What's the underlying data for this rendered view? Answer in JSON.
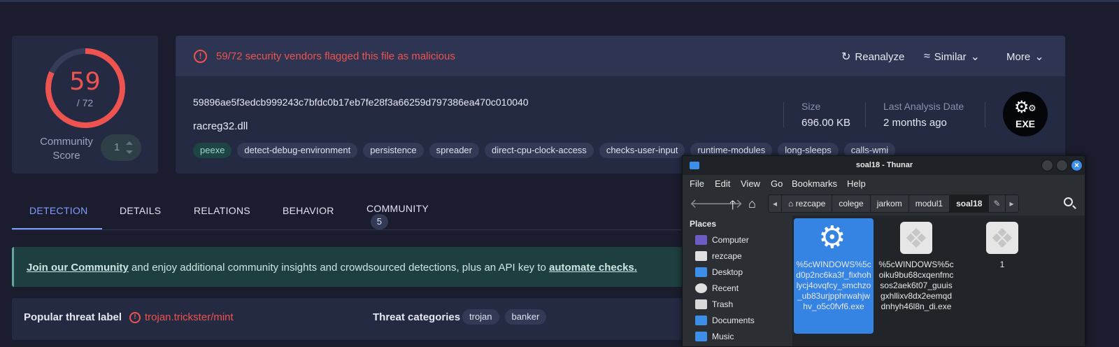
{
  "score": {
    "detections": "59",
    "total": "/ 72",
    "ratio": 0.819,
    "community_label": "Community Score",
    "community_value": "1"
  },
  "alert": {
    "icon": "!",
    "text": "59/72 security vendors flagged this file as malicious"
  },
  "actions": {
    "reanalyze": "Reanalyze",
    "similar": "Similar",
    "more": "More"
  },
  "file": {
    "hash": "59896ae5f3edcb999243c7bfdc0b17eb7fe28f3a66259d797386ea470c010040",
    "name": "racreg32.dll",
    "tags": [
      "peexe",
      "detect-debug-environment",
      "persistence",
      "spreader",
      "direct-cpu-clock-access",
      "checks-user-input",
      "runtime-modules",
      "long-sleeps",
      "calls-wmi"
    ],
    "size_label": "Size",
    "size_value": "696.00 KB",
    "date_label": "Last Analysis Date",
    "date_value": "2 months ago",
    "type_badge": "EXE"
  },
  "tabs": [
    "DETECTION",
    "DETAILS",
    "RELATIONS",
    "BEHAVIOR",
    "COMMUNITY"
  ],
  "community_count": "5",
  "banner": {
    "link1": "Join our Community",
    "text": " and enjoy additional community insights and crowdsourced detections, plus an API key to ",
    "link2": "automate checks."
  },
  "threat": {
    "popular_label": "Popular threat label",
    "popular_value": "trojan.trickster/mint",
    "categories_label": "Threat categories",
    "categories": [
      "trojan",
      "banker"
    ]
  },
  "thunar": {
    "title": "soal18 - Thunar",
    "menu": [
      "File",
      "Edit",
      "View",
      "Go",
      "Bookmarks",
      "Help"
    ],
    "path": [
      "rezcape",
      "colege",
      "jarkom",
      "modul1",
      "soal18"
    ],
    "places_header": "Places",
    "places": [
      "Computer",
      "rezcape",
      "Desktop",
      "Recent",
      "Trash",
      "Documents",
      "Music"
    ],
    "files": [
      "%5cWINDOWS%5cd0p2nc6ka3f_fixhohlycj4ovqfcy_smchzo_ub83urjpphrwahjwhv_o5c0fvf6.exe",
      "%5cWINDOWS%5coiku9bu68cxqenfmcsos2aek6t07_guuisgxhllixv8dx2eemqddnhyh46l8n_di.exe",
      "1"
    ]
  },
  "colors": {
    "accent": "#7f9dff",
    "danger": "#ef5350",
    "panel": "#242a42",
    "selection": "#3584e4"
  }
}
